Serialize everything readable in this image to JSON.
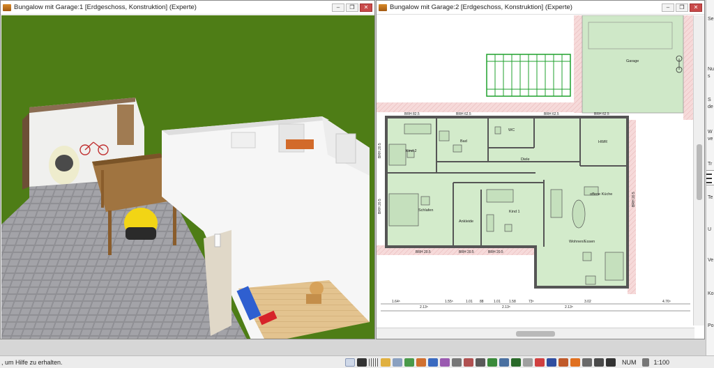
{
  "window_left": {
    "title": "Bungalow mit Garage:1 [Erdgeschoss, Konstruktion] (Experte)",
    "buttons": [
      "‒",
      "❐",
      "✕"
    ]
  },
  "window_right": {
    "title": "Bungalow mit Garage:2 [Erdgeschoss, Konstruktion] (Experte)",
    "buttons": [
      "‒",
      "❐",
      "✕"
    ]
  },
  "floorplan": {
    "rooms": {
      "garage": "Garage",
      "kind2": "Kind 2",
      "bad": "Bad",
      "wc": "WC",
      "hwr": "HWR",
      "diele": "Diele",
      "schlafen": "Schlafen",
      "ankleide": "Ankleide",
      "kind1": "Kind 1",
      "kueche": "offene Küche",
      "wohnen": "Wohnen/Essen"
    },
    "brh_top": [
      "BRH 82.5",
      "BRH 62.5",
      "BRH 62.5",
      "BRH 62.5"
    ],
    "brh_bottom": [
      "BRH 20.5",
      "BRH 20.5",
      "BRH 20.5"
    ],
    "brh_side": [
      "BRH 20.5",
      "BRH 20.5",
      "BRH 20.5"
    ],
    "dims_top": [
      "1.64⁵",
      "1.55⁵",
      "1.01",
      "88",
      "1.01",
      "1.58",
      "73⁵",
      "3.02",
      "4.76⁵"
    ],
    "dims_bottom": [
      "2.13⁵",
      "2.13⁵",
      "2.13⁵"
    ]
  },
  "sidepanel": {
    "items": [
      "Se",
      "Nu",
      "s",
      "S",
      "de",
      "W",
      "ve",
      "Tr",
      "Te",
      "U",
      "Ve",
      "Ko",
      "Po"
    ]
  },
  "statusbar": {
    "help_text": ", um Hilfe zu erhalten.",
    "num": "NUM",
    "scale": "1:100"
  },
  "colors": {
    "grass": "#4e7d16",
    "room_fill": "#d3ebcb",
    "wall": "#555555",
    "hatch_pink": "#f4d2d2",
    "garage_fill": "#cfe8c8",
    "window_green": "#1fa02c"
  }
}
